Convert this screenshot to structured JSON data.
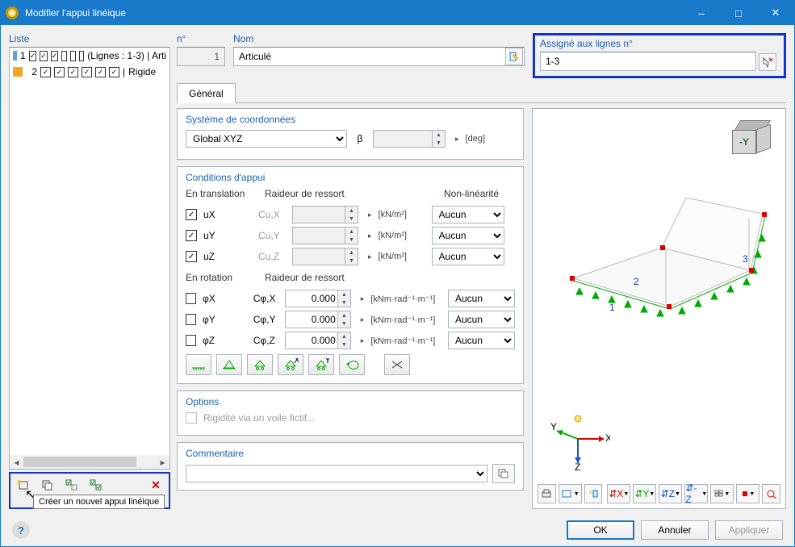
{
  "window": {
    "title": "Modifier l'appui linéique"
  },
  "list": {
    "header": "Liste",
    "items": [
      {
        "num": "1",
        "checks": [
          true,
          true,
          true,
          false,
          false,
          false
        ],
        "text": "(Lignes : 1-3) | Arti"
      },
      {
        "num": "2",
        "checks": [
          true,
          true,
          true,
          true,
          true,
          true
        ],
        "text": "Rigide"
      }
    ],
    "tooltip": "Créer un nouvel appui linéique"
  },
  "numero": {
    "label": "n°",
    "value": "1"
  },
  "nom": {
    "label": "Nom",
    "value": "Articulé"
  },
  "assigned": {
    "label": "Assigné aux lignes n°",
    "value": "1-3"
  },
  "tabs": {
    "general": "Général"
  },
  "coord": {
    "title": "Système de coordonnées",
    "select": "Global XYZ",
    "beta_label": "β",
    "beta_unit": "[deg]"
  },
  "support": {
    "title": "Conditions d'appui",
    "translation_h": "En translation",
    "spring_h": "Raideur de ressort",
    "nonlin_h": "Non-linéarité",
    "rotation_h": "En rotation",
    "unit_trans": "[kN/m²]",
    "unit_rot": "[kNm·rad⁻¹·m⁻¹]",
    "nonlin_none": "Aucun",
    "trans": [
      {
        "sym": "uX",
        "chk": true,
        "coef": "Cu,X",
        "val": ""
      },
      {
        "sym": "uY",
        "chk": true,
        "coef": "Cu,Y",
        "val": ""
      },
      {
        "sym": "uZ",
        "chk": true,
        "coef": "Cu,Z",
        "val": ""
      }
    ],
    "rot": [
      {
        "sym": "φX",
        "chk": false,
        "coef": "Cφ,X",
        "val": "0.000"
      },
      {
        "sym": "φY",
        "chk": false,
        "coef": "Cφ,Y",
        "val": "0.000"
      },
      {
        "sym": "φZ",
        "chk": false,
        "coef": "Cφ,Z",
        "val": "0.000"
      }
    ]
  },
  "options": {
    "title": "Options",
    "fictitious": "Rigidité via un voile fictif..."
  },
  "comment": {
    "title": "Commentaire"
  },
  "footer": {
    "ok": "OK",
    "cancel": "Annuler",
    "apply": "Appliquer"
  },
  "axis": {
    "x": "X",
    "y": "Y",
    "z": "Z",
    "cube": "-Y"
  },
  "colors": {
    "accent": "#1979ca"
  }
}
